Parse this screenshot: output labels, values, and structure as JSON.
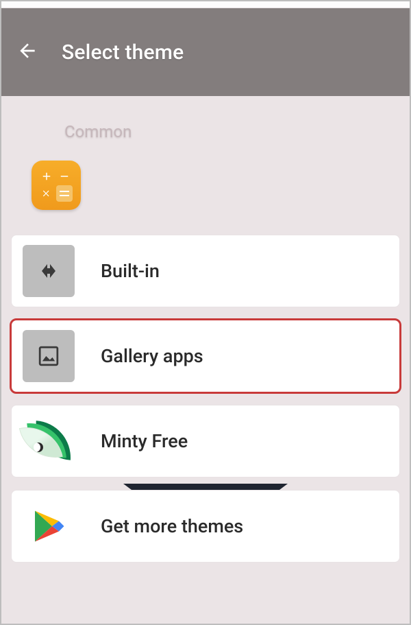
{
  "appbar": {
    "title": "Select theme"
  },
  "section": {
    "label": "Common"
  },
  "items": {
    "builtin": {
      "label": "Built-in"
    },
    "gallery": {
      "label": "Gallery apps"
    },
    "minty": {
      "label": "Minty Free"
    },
    "more": {
      "label": "Get more themes"
    }
  }
}
